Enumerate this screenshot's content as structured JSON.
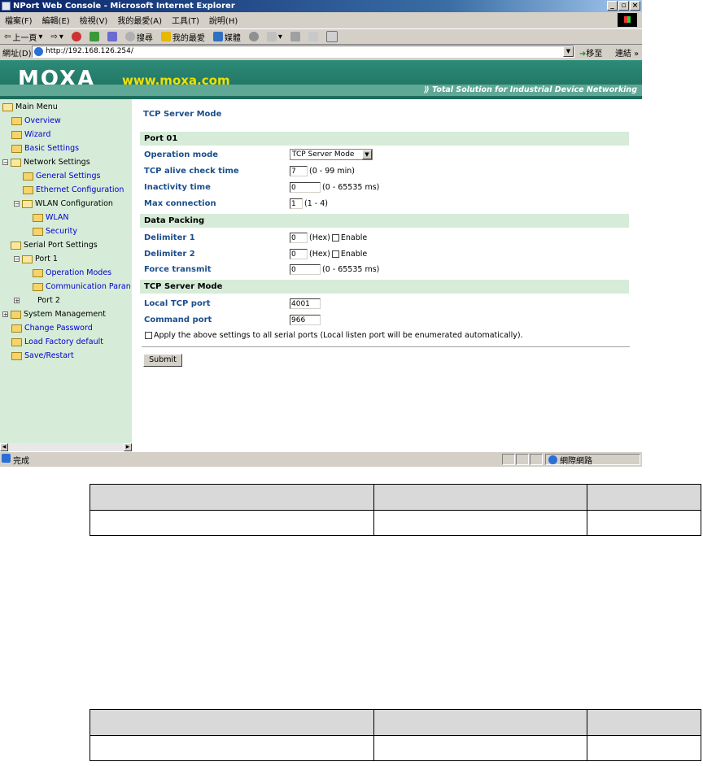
{
  "window": {
    "title": "NPort Web Console - Microsoft Internet Explorer",
    "buttons": {
      "minimize": "_",
      "maximize": "▫",
      "close": "×"
    }
  },
  "menubar": [
    "檔案(F)",
    "編輯(E)",
    "檢視(V)",
    "我的最愛(A)",
    "工具(T)",
    "說明(H)"
  ],
  "toolbar": {
    "back": "上一頁",
    "search": "搜尋",
    "favorites": "我的最愛",
    "media": "媒體"
  },
  "addressbar": {
    "label": "網址(D)",
    "url": "http://192.168.126.254/",
    "go": "移至",
    "links": "連結"
  },
  "banner": {
    "logo": "MOXA",
    "url": "www.moxa.com",
    "slogan": "Total Solution for Industrial Device Networking"
  },
  "sidebar": {
    "items": [
      {
        "label": "Main Menu"
      },
      {
        "label": "Overview"
      },
      {
        "label": "Wizard"
      },
      {
        "label": "Basic Settings"
      },
      {
        "label": "Network Settings"
      },
      {
        "label": "General Settings"
      },
      {
        "label": "Ethernet Configuration"
      },
      {
        "label": "WLAN Configuration"
      },
      {
        "label": "WLAN"
      },
      {
        "label": "Security"
      },
      {
        "label": "Serial Port Settings"
      },
      {
        "label": "Port 1"
      },
      {
        "label": "Operation Modes"
      },
      {
        "label": "Communication Paran"
      },
      {
        "label": "Port 2"
      },
      {
        "label": "System Management"
      },
      {
        "label": "Change Password"
      },
      {
        "label": "Load Factory default"
      },
      {
        "label": "Save/Restart"
      }
    ],
    "toggle_plus": "+",
    "toggle_minus": "−"
  },
  "page": {
    "title": "TCP Server Mode",
    "sections": {
      "port": "Port 01",
      "packing": "Data Packing",
      "server": "TCP Server Mode"
    },
    "fields": {
      "operation_mode": {
        "label": "Operation mode",
        "value": "TCP Server Mode"
      },
      "alive_check": {
        "label": "TCP alive check time",
        "value": "7",
        "hint": "(0 - 99 min)"
      },
      "inactivity": {
        "label": "Inactivity time",
        "value": "0",
        "hint": "(0 - 65535 ms)"
      },
      "max_conn": {
        "label": "Max connection",
        "value": "1",
        "hint": "(1 - 4)"
      },
      "delim1": {
        "label": "Delimiter 1",
        "value": "0",
        "hint": "(Hex)",
        "enable": "Enable"
      },
      "delim2": {
        "label": "Delimiter 2",
        "value": "0",
        "hint": "(Hex)",
        "enable": "Enable"
      },
      "force_tx": {
        "label": "Force transmit",
        "value": "0",
        "hint": "(0 - 65535 ms)"
      },
      "local_port": {
        "label": "Local TCP port",
        "value": "4001"
      },
      "cmd_port": {
        "label": "Command port",
        "value": "966"
      }
    },
    "apply_all": "Apply the above settings to all serial ports (Local listen port will be enumerated automatically).",
    "submit": "Submit"
  },
  "statusbar": {
    "text": "完成",
    "zone": "網際網路"
  },
  "tables": [
    {
      "header": [
        "",
        "",
        ""
      ],
      "row": [
        "",
        "",
        ""
      ]
    },
    {
      "header": [
        "",
        "",
        ""
      ],
      "row": [
        "",
        "",
        ""
      ]
    }
  ]
}
